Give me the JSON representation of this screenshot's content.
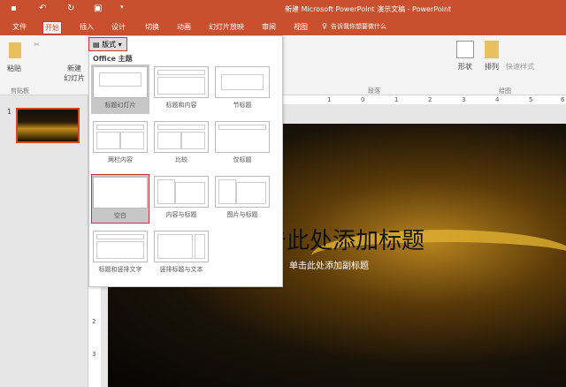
{
  "window": {
    "title": "新建 Microsoft PowerPoint 演示文稿 - PowerPoint"
  },
  "tabs": [
    "文件",
    "开始",
    "插入",
    "设计",
    "切换",
    "动画",
    "幻灯片放映",
    "审阅",
    "视图"
  ],
  "tell_me": "告诉我你想要做什么",
  "ribbon": {
    "paste": "粘贴",
    "new_slide": "新建\n幻灯片",
    "layout": "版式",
    "shapes": "形状",
    "arrange": "排列",
    "quick_styles": "快速样式",
    "groups": {
      "clipboard": "剪贴板",
      "paragraph": "段落",
      "drawing": "绘图"
    }
  },
  "ruler": [
    "1",
    "0",
    "1",
    "2",
    "3",
    "4",
    "5",
    "6"
  ],
  "vruler": [
    "2",
    "3"
  ],
  "thumbnail_number": "1",
  "layout_gallery": {
    "header": "Office 主题",
    "items": [
      "标题幻灯片",
      "标题和内容",
      "节标题",
      "两栏内容",
      "比较",
      "仅标题",
      "空白",
      "内容与标题",
      "图片与标题",
      "标题和竖排文字",
      "竖排标题与文本"
    ],
    "selected": "标题幻灯片",
    "highlighted": "空白"
  },
  "slide": {
    "title_placeholder": "单击此处添加标题",
    "subtitle_placeholder": "单击此处添加副标题"
  },
  "colors": {
    "accent": "#c9502e",
    "highlight": "#d0303a"
  }
}
